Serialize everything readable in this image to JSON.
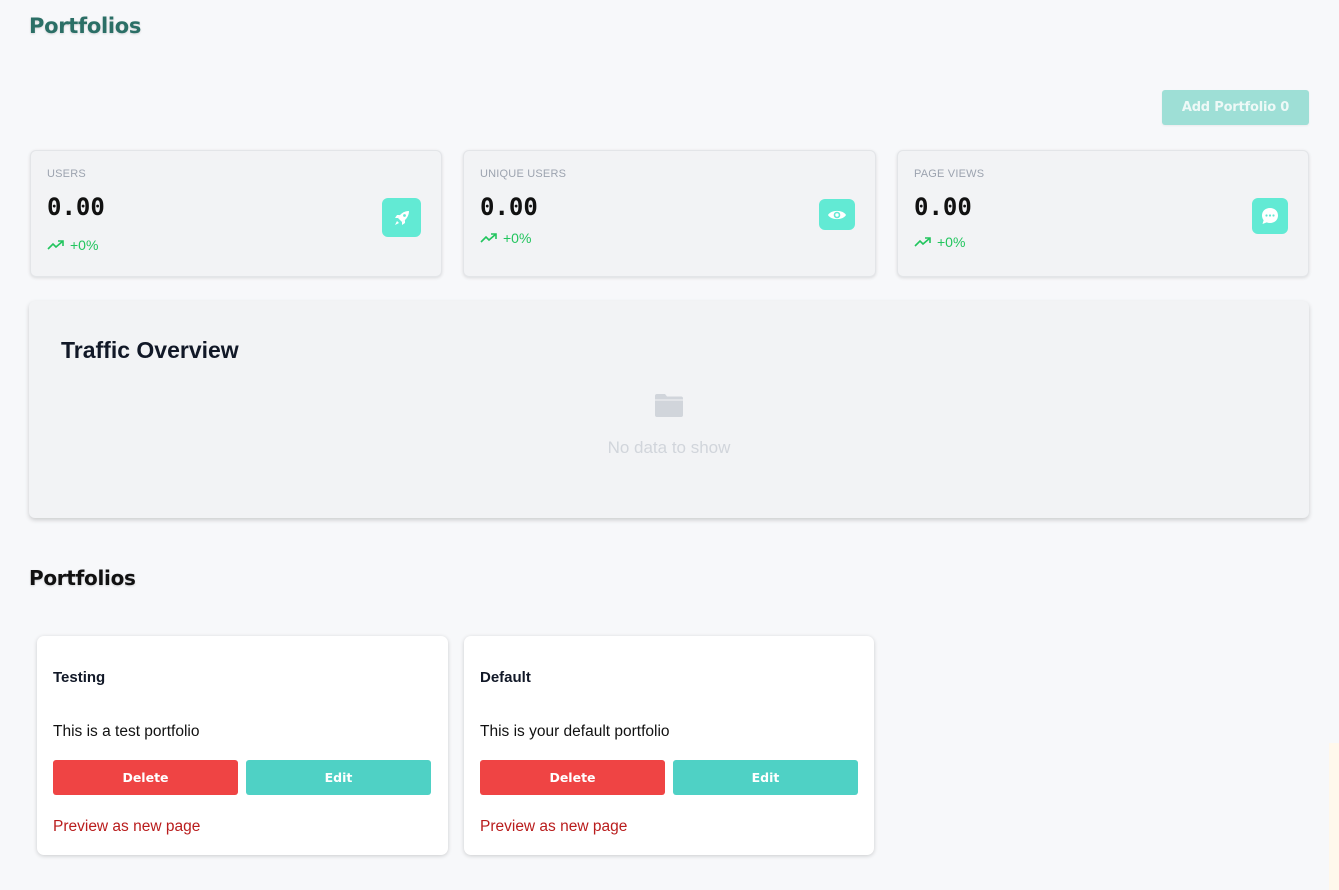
{
  "header": {
    "title": "Portfolios",
    "add_button_label": "Add Portfolio 0"
  },
  "stats": [
    {
      "label": "USERS",
      "value": "0.00",
      "trend": "+0%",
      "icon": "rocket-icon"
    },
    {
      "label": "UNIQUE USERS",
      "value": "0.00",
      "trend": "+0%",
      "icon": "eye-icon"
    },
    {
      "label": "PAGE VIEWS",
      "value": "0.00",
      "trend": "+0%",
      "icon": "chat-bubble-icon"
    }
  ],
  "traffic": {
    "title": "Traffic Overview",
    "empty_icon": "folder-icon",
    "empty_text": "No data to show"
  },
  "portfolios_section": {
    "title": "Portfolios",
    "items": [
      {
        "name": "Testing",
        "description": "This is a test portfolio",
        "delete_label": "Delete",
        "edit_label": "Edit",
        "preview_label": "Preview as new page"
      },
      {
        "name": "Default",
        "description": "This is your default portfolio",
        "delete_label": "Delete",
        "edit_label": "Edit",
        "preview_label": "Preview as new page"
      }
    ]
  },
  "colors": {
    "title_teal": "#2b6f66",
    "accent_mint": "#62ead4",
    "trend_green": "#22c55e",
    "delete_red": "#ef4444",
    "edit_teal": "#4fd1c5",
    "link_red": "#b91c1c",
    "add_button_disabled": "#9edfd6"
  }
}
